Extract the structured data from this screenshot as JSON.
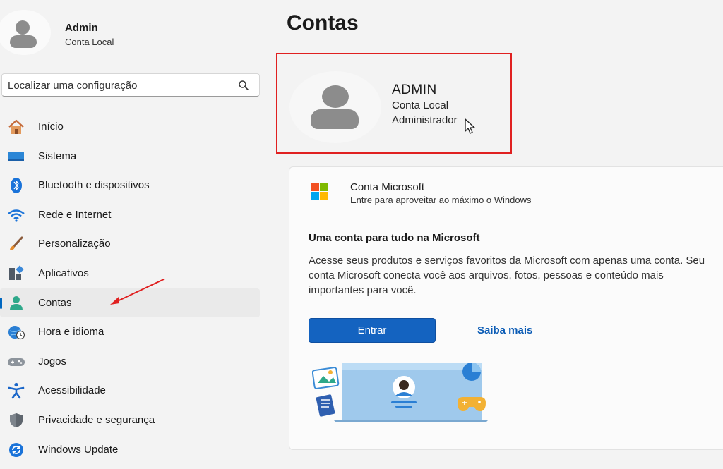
{
  "user": {
    "name": "Admin",
    "account_type": "Conta Local"
  },
  "search": {
    "placeholder": "Localizar uma configuração"
  },
  "sidebar": {
    "items": [
      {
        "label": "Início",
        "icon": "home-icon",
        "active": false
      },
      {
        "label": "Sistema",
        "icon": "system-icon",
        "active": false
      },
      {
        "label": "Bluetooth e dispositivos",
        "icon": "bluetooth-icon",
        "active": false
      },
      {
        "label": "Rede e Internet",
        "icon": "wifi-icon",
        "active": false
      },
      {
        "label": "Personalização",
        "icon": "brush-icon",
        "active": false
      },
      {
        "label": "Aplicativos",
        "icon": "apps-icon",
        "active": false
      },
      {
        "label": "Contas",
        "icon": "accounts-icon",
        "active": true
      },
      {
        "label": "Hora e idioma",
        "icon": "globe-clock-icon",
        "active": false
      },
      {
        "label": "Jogos",
        "icon": "gamepad-icon",
        "active": false
      },
      {
        "label": "Acessibilidade",
        "icon": "accessibility-icon",
        "active": false
      },
      {
        "label": "Privacidade e segurança",
        "icon": "shield-icon",
        "active": false
      },
      {
        "label": "Windows Update",
        "icon": "update-icon",
        "active": false
      }
    ]
  },
  "main": {
    "title": "Contas",
    "account": {
      "name": "ADMIN",
      "type": "Conta Local",
      "role": "Administrador"
    },
    "microsoft_card": {
      "title": "Conta Microsoft",
      "subtitle": "Entre para aproveitar ao máximo o Windows",
      "promo_title": "Uma conta para tudo na Microsoft",
      "promo_text": "Acesse seus produtos e serviços favoritos da Microsoft com apenas uma conta. Seu conta Microsoft conecta você aos arquivos, fotos, pessoas e conteúdo mais importantes para você.",
      "login_button": "Entrar",
      "learn_more": "Saiba mais"
    }
  },
  "colors": {
    "accent": "#0067c0",
    "button": "#1463c0",
    "highlight_border": "#e02020",
    "background": "#f3f3f3"
  }
}
